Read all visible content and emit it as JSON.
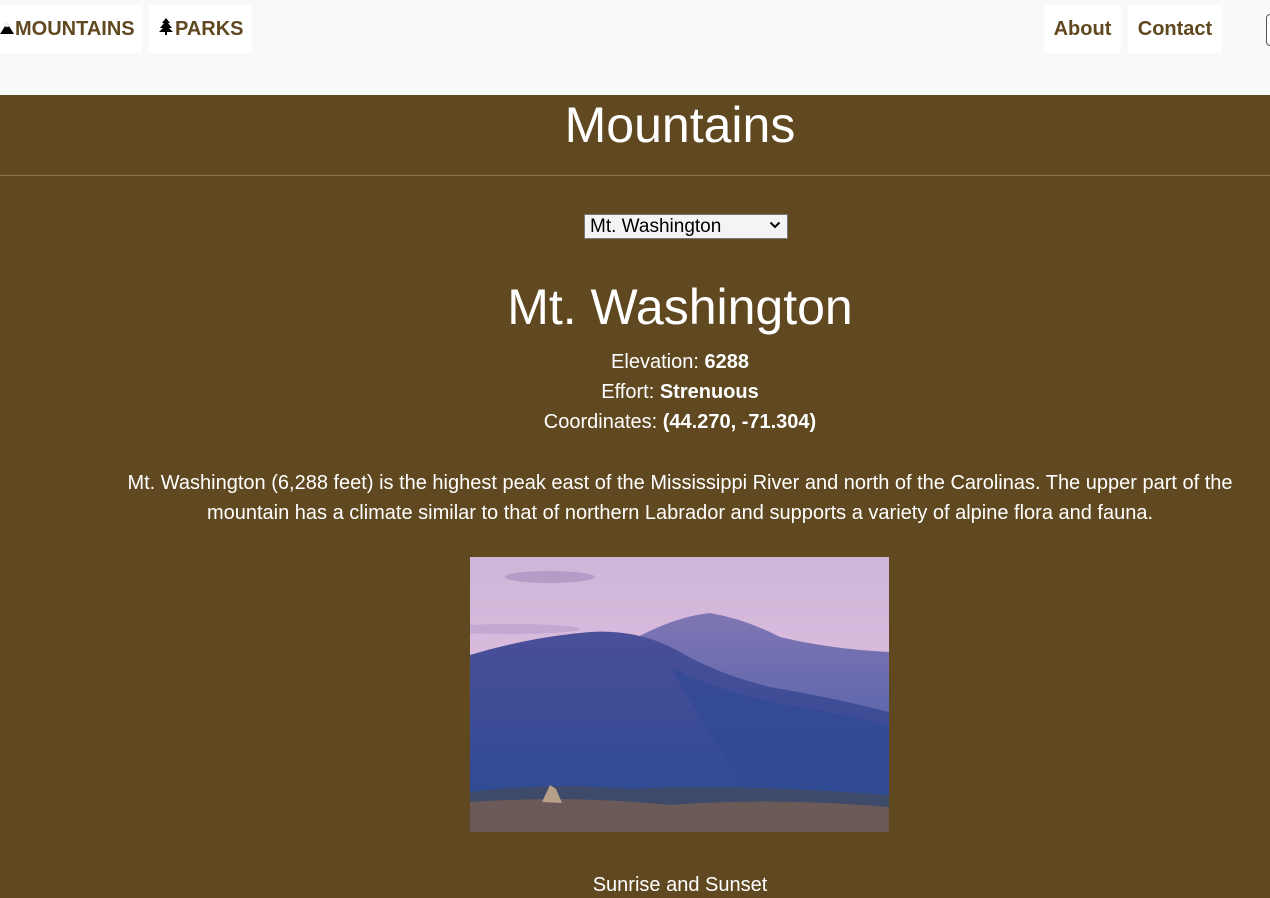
{
  "nav": {
    "mountains_label": "MOUNTAINS",
    "mountains_icon": "mountain-icon",
    "parks_label": "PARKS",
    "parks_icon": "tree-icon",
    "about_label": "About",
    "contact_label": "Contact"
  },
  "page": {
    "title": "Mountains"
  },
  "selector": {
    "selected": "Mt. Washington"
  },
  "mountain": {
    "name": "Mt. Washington",
    "elevation_label": "Elevation:",
    "elevation_value": "6288",
    "effort_label": "Effort:",
    "effort_value": "Strenuous",
    "coords_label": "Coordinates:",
    "coords_value": "(44.270, -71.304)",
    "description": "Mt. Washington (6,288 feet) is the highest peak east of the Mississippi River and north of the Carolinas. The upper part of the mountain has a climate similar to that of northern Labrador and supports a variety of alpine flora and fauna.",
    "photo_icon": "mountain-photo",
    "section_caption": "Sunrise and Sunset"
  },
  "colors": {
    "background": "#604920",
    "nav_text": "#604920",
    "topbar": "#f8f9fa"
  }
}
